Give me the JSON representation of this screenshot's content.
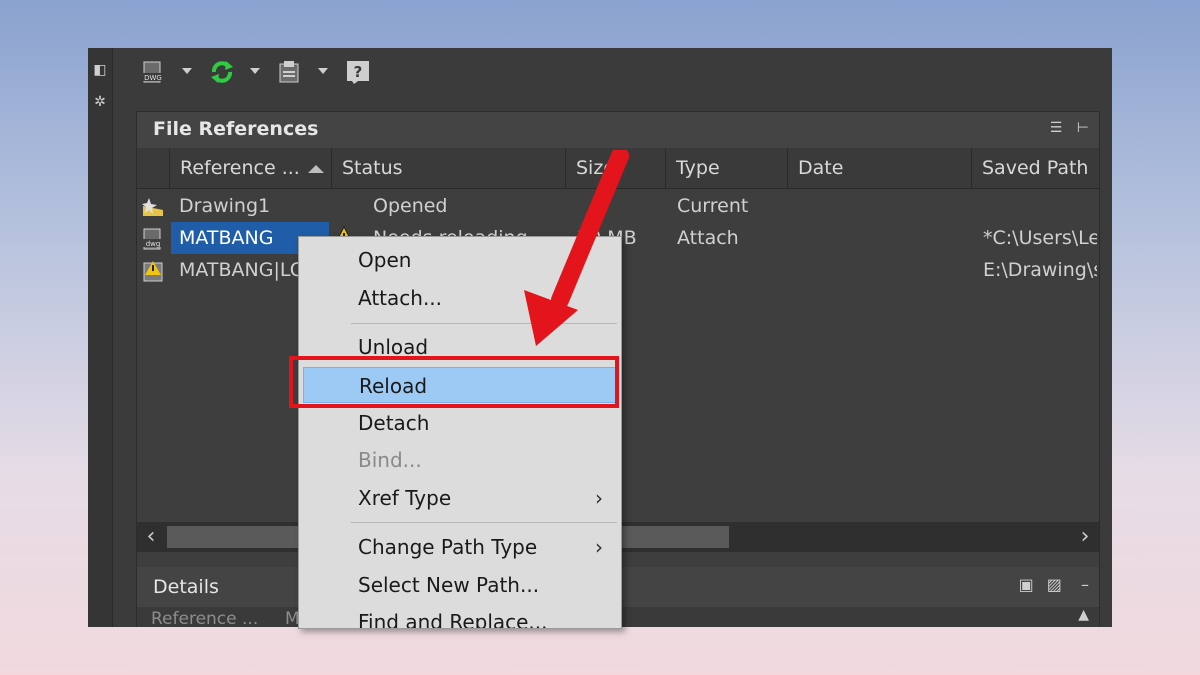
{
  "app": {
    "panel_title": "File References",
    "details_title": "Details",
    "details_first_label": "Reference ...",
    "details_first_value": "M"
  },
  "toolbar": {
    "buttons": [
      {
        "icon": "attach-dwg-icon",
        "label": "DWG"
      },
      {
        "icon": "refresh-icon"
      },
      {
        "icon": "change-path-icon"
      },
      {
        "icon": "help-icon",
        "label": "?"
      }
    ]
  },
  "columns": [
    "Reference ...",
    "Status",
    "Size",
    "Type",
    "Date",
    "Saved Path"
  ],
  "rows": [
    {
      "name": "Drawing1",
      "status": "Opened",
      "size": "",
      "type": "Current",
      "date": "",
      "saved_path": "",
      "icon": "drawing-icon"
    },
    {
      "name": "MATBANG",
      "status": "Needs reloading",
      "size": "20 MB",
      "type": "Attach",
      "date": "",
      "saved_path": "*C:\\Users\\Le",
      "icon": "dwg-file-icon",
      "selected": true,
      "warning": true
    },
    {
      "name": "MATBANG|LO",
      "status": "",
      "size": "",
      "type": "",
      "date": "",
      "saved_path": "E:\\Drawing\\s",
      "icon": "warning-file-icon"
    }
  ],
  "context_menu": {
    "items": [
      {
        "label": "Open"
      },
      {
        "label": "Attach..."
      },
      {
        "label": "Unload"
      },
      {
        "label": "Reload",
        "highlighted": true
      },
      {
        "label": "Detach"
      },
      {
        "label": "Bind...",
        "disabled": true
      },
      {
        "label": "Xref Type",
        "submenu": true
      },
      {
        "label": "Change Path Type",
        "submenu": true
      },
      {
        "label": "Select New Path..."
      },
      {
        "label": "Find and Replace..."
      }
    ]
  },
  "colors": {
    "selection": "#1f5da8",
    "menu_highlight": "#9ccaf4",
    "annotation_red": "#e3141b",
    "refresh_green": "#2ecc40"
  }
}
